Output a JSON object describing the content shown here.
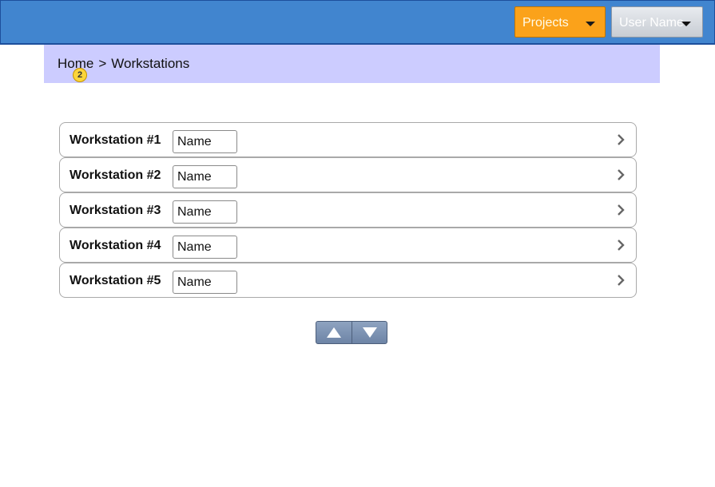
{
  "header": {
    "projects_label": "Projects",
    "user_label": "User Name",
    "colors": {
      "bar": "#4185cf",
      "projects": "#fba21a"
    }
  },
  "breadcrumb": {
    "home": "Home",
    "separator": ">",
    "current": "Workstations",
    "badge": "2"
  },
  "workstations": [
    {
      "title": "Workstation #1",
      "name_value": "Name"
    },
    {
      "title": "Workstation #2",
      "name_value": "Name"
    },
    {
      "title": "Workstation #3",
      "name_value": "Name"
    },
    {
      "title": "Workstation #4",
      "name_value": "Name"
    },
    {
      "title": "Workstation #5",
      "name_value": "Name"
    }
  ],
  "icons": {
    "row_arrow": "chevron-right-icon",
    "pager_up": "arrow-up-icon",
    "pager_down": "arrow-down-icon"
  }
}
